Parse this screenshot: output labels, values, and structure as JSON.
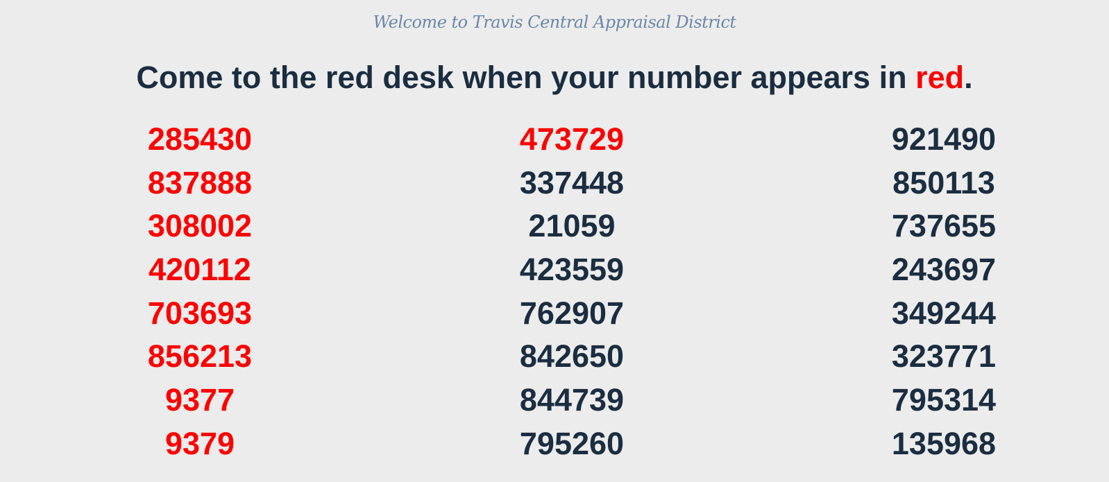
{
  "header": {
    "welcome": "Welcome to Travis Central Appraisal District"
  },
  "instruction": {
    "before": "Come to the red desk when your number appears in ",
    "highlight": "red",
    "after": "."
  },
  "colors": {
    "called": "#ff0000",
    "waiting": "#1b2d40",
    "background": "#ececec",
    "welcome_text": "#6b86a8"
  },
  "columns": [
    {
      "numbers": [
        {
          "value": "285430",
          "called": true
        },
        {
          "value": "837888",
          "called": true
        },
        {
          "value": "308002",
          "called": true
        },
        {
          "value": "420112",
          "called": true
        },
        {
          "value": "703693",
          "called": true
        },
        {
          "value": "856213",
          "called": true
        },
        {
          "value": "9377",
          "called": true
        },
        {
          "value": "9379",
          "called": true
        }
      ]
    },
    {
      "numbers": [
        {
          "value": "473729",
          "called": true
        },
        {
          "value": "337448",
          "called": false
        },
        {
          "value": "21059",
          "called": false
        },
        {
          "value": "423559",
          "called": false
        },
        {
          "value": "762907",
          "called": false
        },
        {
          "value": "842650",
          "called": false
        },
        {
          "value": "844739",
          "called": false
        },
        {
          "value": "795260",
          "called": false
        }
      ]
    },
    {
      "numbers": [
        {
          "value": "921490",
          "called": false
        },
        {
          "value": "850113",
          "called": false
        },
        {
          "value": "737655",
          "called": false
        },
        {
          "value": "243697",
          "called": false
        },
        {
          "value": "349244",
          "called": false
        },
        {
          "value": "323771",
          "called": false
        },
        {
          "value": "795314",
          "called": false
        },
        {
          "value": "135968",
          "called": false
        }
      ]
    }
  ]
}
